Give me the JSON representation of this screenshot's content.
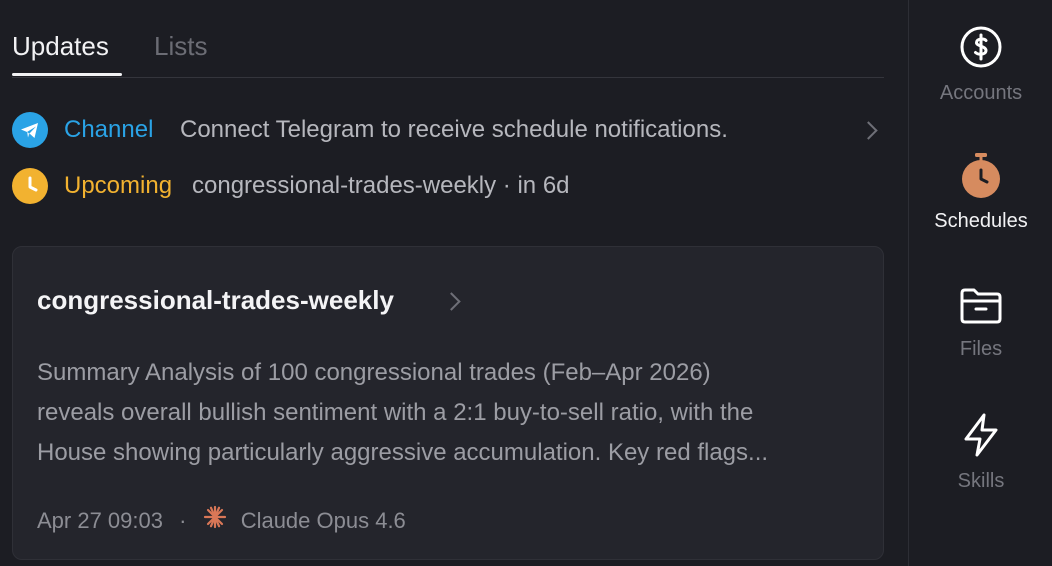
{
  "tabs": [
    {
      "label": "Updates",
      "active": true
    },
    {
      "label": "Lists",
      "active": false
    }
  ],
  "notices": [
    {
      "kind": "Channel",
      "message": "Connect Telegram to receive schedule notifications.",
      "icon": "telegram-icon",
      "color": "#2aa3e6"
    },
    {
      "kind": "Upcoming",
      "message": "congressional-trades-weekly · in 6d",
      "icon": "clock-icon",
      "color": "#f2b230"
    }
  ],
  "card": {
    "title": "congressional-trades-weekly",
    "summary_lines": [
      "Summary Analysis of 100 congressional trades (Feb–Apr 2026)",
      "reveals overall bullish sentiment with a 2:1 buy-to-sell ratio, with the",
      "House showing particularly aggressive accumulation. Key red flags..."
    ],
    "timestamp": "Apr 27 09:03",
    "separator": "·",
    "model": "Claude Opus 4.6",
    "model_icon": "claude-spark-icon",
    "model_color": "#d97757"
  },
  "rail": [
    {
      "label": "Accounts",
      "icon": "dollar-circle-icon",
      "active": false
    },
    {
      "label": "Schedules",
      "icon": "stopwatch-icon",
      "active": true
    },
    {
      "label": "Files",
      "icon": "folder-icon",
      "active": false
    },
    {
      "label": "Skills",
      "icon": "lightning-icon",
      "active": false
    }
  ],
  "colors": {
    "background": "#1c1d23",
    "card": "#24252c",
    "channel_accent": "#2aa3e6",
    "upcoming_accent": "#f2b230",
    "schedule_icon": "#d68b5f"
  }
}
